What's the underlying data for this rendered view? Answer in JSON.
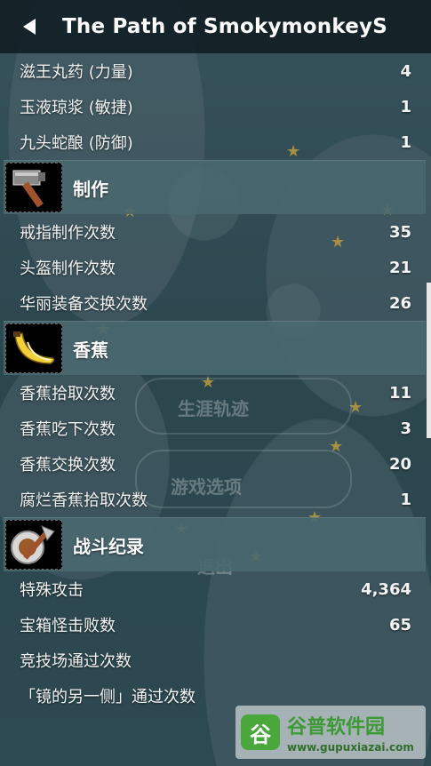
{
  "header": {
    "title": "The Path of SmokymonkeyS"
  },
  "sections": [
    {
      "title": "",
      "rows": [
        {
          "label": "滋王丸药 (力量)",
          "value": "4"
        },
        {
          "label": "玉液琼浆 (敏捷)",
          "value": "1"
        },
        {
          "label": "九头蛇酿 (防御)",
          "value": "1"
        }
      ]
    },
    {
      "title": "制作",
      "icon": "hammer-icon",
      "rows": [
        {
          "label": "戒指制作次数",
          "value": "35"
        },
        {
          "label": "头盔制作次数",
          "value": "21"
        },
        {
          "label": "华丽装备交换次数",
          "value": "26"
        }
      ]
    },
    {
      "title": "香蕉",
      "icon": "banana-icon",
      "rows": [
        {
          "label": "香蕉拾取次数",
          "value": "11"
        },
        {
          "label": "香蕉吃下次数",
          "value": "3"
        },
        {
          "label": "香蕉交换次数",
          "value": "20"
        },
        {
          "label": "腐烂香蕉拾取次数",
          "value": "1"
        }
      ]
    },
    {
      "title": "战斗纪录",
      "icon": "battle-axe-icon",
      "rows": [
        {
          "label": "特殊攻击",
          "value": "4,364"
        },
        {
          "label": "宝箱怪击败数",
          "value": "65"
        },
        {
          "label": "竞技场通过次数",
          "value": ""
        },
        {
          "label": "「镜的另一侧」通过次数",
          "value": ""
        }
      ]
    }
  ],
  "background_menu": {
    "item1": "生涯轨迹",
    "item2": "游戏选项",
    "item3": "退出"
  },
  "watermark": {
    "logo": "谷",
    "name": "谷普软件园",
    "url": "www.gupuxiazai.com"
  },
  "colors": {
    "section_bg": "#496870",
    "star": "#b89a3c",
    "titlebar": "#142128"
  }
}
